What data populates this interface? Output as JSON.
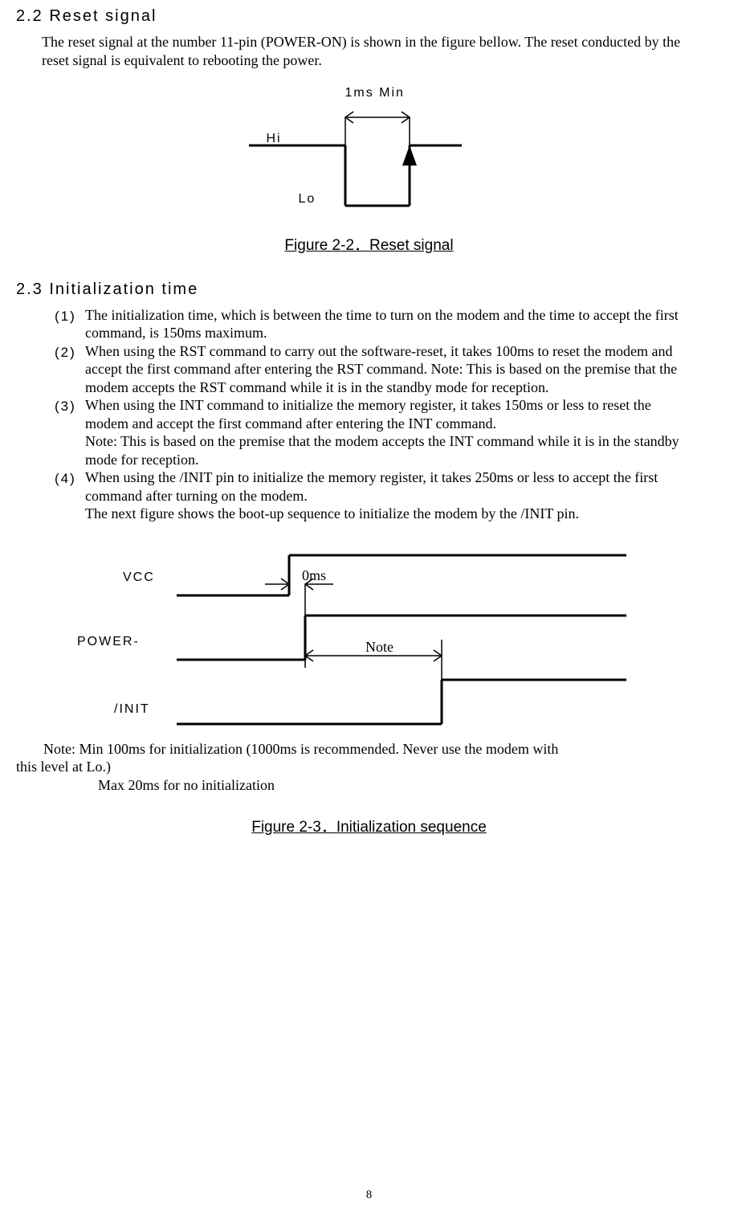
{
  "sec22": {
    "head": "2.2   Reset signal",
    "p1": "The reset signal at the number 11-pin (POWER-ON) is shown in the figure bellow. The reset conducted by the reset signal is equivalent to rebooting the power."
  },
  "fig1": {
    "time_label": "1ms Min",
    "hi": "Hi",
    "lo": "Lo",
    "caption": "Figure  2-2．Reset signal"
  },
  "sec23": {
    "head": "2.3   Initialization time",
    "items": [
      {
        "n": "(1)",
        "t": "The initialization time, which is between the time to turn on the modem and the time to accept the first command, is 150ms maximum."
      },
      {
        "n": "(2)",
        "t": "When using the RST command to carry out the software-reset, it takes 100ms to reset the modem and accept the first command after entering the RST command. Note: This is based on the premise that the modem accepts the RST command while it is in the standby mode for reception."
      },
      {
        "n": "(3)",
        "t": "When using the INT command to initialize the memory register, it takes 150ms or less to reset the modem and accept the first command after entering the INT command.\nNote: This is based on the premise that the modem accepts the INT command while it is in the standby mode for reception."
      },
      {
        "n": "(4)",
        "t": "When using the /INIT pin to initialize the memory register, it takes 250ms or less to accept the first command after turning on the modem.\nThe next figure shows the boot-up sequence to initialize the modem by the /INIT pin."
      }
    ]
  },
  "fig2": {
    "vcc": "VCC",
    "poweron": "POWER-",
    "init": "/INIT",
    "zero": "0ms",
    "note": "Note",
    "caption": "Figure  2-3．Initialization sequence"
  },
  "notes": {
    "l1_prefix": "Note: Min 100ms for initialization (1000ms is recommended. Never use the modem with",
    "l1_cont": "this level at Lo.)",
    "l2": "Max 20ms for no initialization"
  },
  "page_number": "8"
}
